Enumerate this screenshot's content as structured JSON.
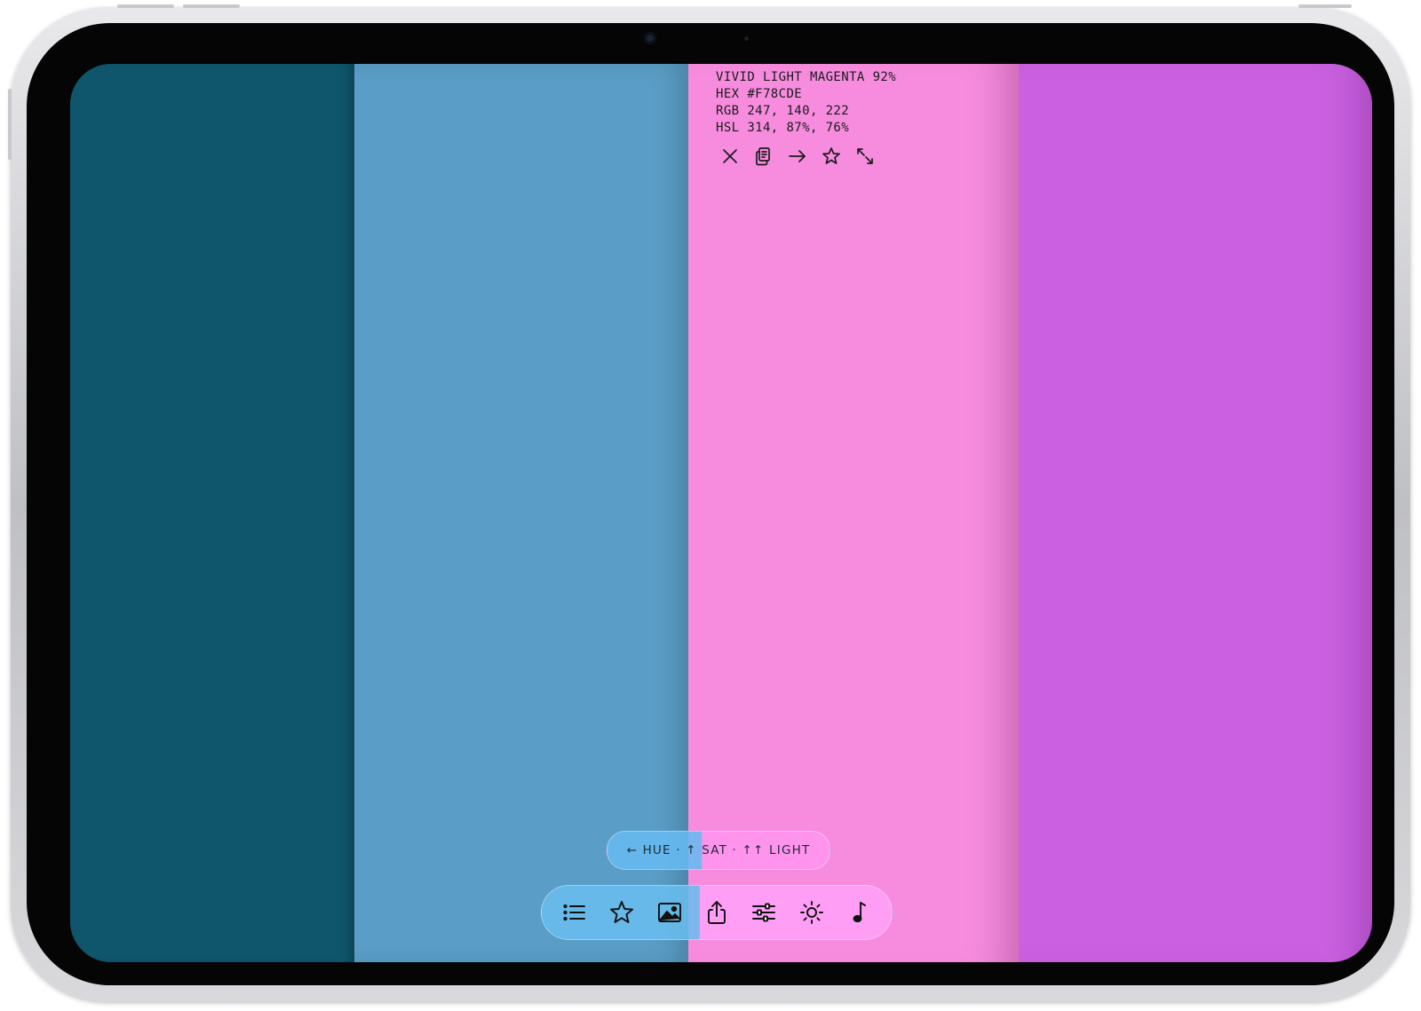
{
  "swatches": [
    {
      "color": "#0f566c"
    },
    {
      "color": "#5a9dc6"
    },
    {
      "color": "#f78cde"
    },
    {
      "color": "#cb61e0"
    }
  ],
  "selected_swatch": {
    "name_line": "VIVID LIGHT MAGENTA 92%",
    "hex_line": "HEX #F78CDE",
    "rgb_line": "RGB 247, 140, 222",
    "hsl_line": "HSL 314, 87%, 76%",
    "actions": [
      "close-icon",
      "copy-icon",
      "arrow-right-icon",
      "star-icon",
      "expand-icon"
    ]
  },
  "hint": {
    "text": "← HUE · ↑ SAT · ↑↑ LIGHT"
  },
  "toolbar": {
    "items": [
      "list-icon",
      "star-icon",
      "image-icon",
      "share-icon",
      "sliders-icon",
      "sun-icon",
      "music-note-icon"
    ]
  }
}
